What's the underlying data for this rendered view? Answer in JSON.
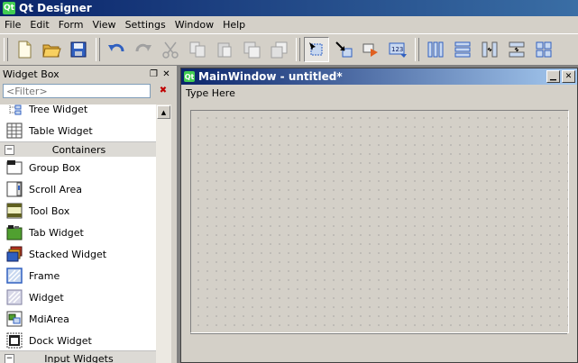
{
  "app": {
    "title": "Qt Designer",
    "logo_text": "Qt"
  },
  "menubar": {
    "items": [
      "File",
      "Edit",
      "Form",
      "View",
      "Settings",
      "Window",
      "Help"
    ]
  },
  "toolbar": {
    "icons": [
      "new-file-icon",
      "open-folder-icon",
      "save-icon",
      "undo-icon",
      "redo-icon",
      "cut-icon",
      "copy-icon",
      "paste-icon",
      "raise-icon",
      "lower-icon",
      "edit-widgets-icon",
      "edit-signals-slots-icon",
      "edit-buddies-icon",
      "edit-tab-order-icon",
      "layout-horizontal-icon",
      "layout-vertical-icon",
      "layout-h-splitter-icon",
      "layout-v-splitter-icon",
      "layout-grid-icon"
    ]
  },
  "widget_box": {
    "title": "Widget Box",
    "float_glyph": "❐",
    "close_glyph": "✕",
    "filter_placeholder": "<Filter>",
    "clear_glyph": "✖",
    "scroll_up_glyph": "▲",
    "items_top": [
      {
        "label": "Tree Widget",
        "icon": "tree-widget-icon"
      },
      {
        "label": "Table Widget",
        "icon": "table-widget-icon"
      }
    ],
    "category_containers": {
      "label": "Containers",
      "toggle": "−"
    },
    "containers": [
      {
        "label": "Group Box",
        "icon": "group-box-icon"
      },
      {
        "label": "Scroll Area",
        "icon": "scroll-area-icon"
      },
      {
        "label": "Tool Box",
        "icon": "tool-box-icon"
      },
      {
        "label": "Tab Widget",
        "icon": "tab-widget-icon"
      },
      {
        "label": "Stacked Widget",
        "icon": "stacked-widget-icon"
      },
      {
        "label": "Frame",
        "icon": "frame-icon"
      },
      {
        "label": "Widget",
        "icon": "widget-icon"
      },
      {
        "label": "MdiArea",
        "icon": "mdi-area-icon"
      },
      {
        "label": "Dock Widget",
        "icon": "dock-widget-icon"
      }
    ],
    "category_input": {
      "label": "Input Widgets",
      "toggle": "−"
    }
  },
  "form_window": {
    "title": "MainWindow - untitled*",
    "logo_text": "Qt",
    "minimize_glyph": "▁",
    "close_glyph": "✕",
    "menu_placeholder": "Type Here"
  },
  "colors": {
    "title_dark": "#0a246a",
    "title_light": "#a6caf0",
    "chrome": "#d4d0c8"
  }
}
